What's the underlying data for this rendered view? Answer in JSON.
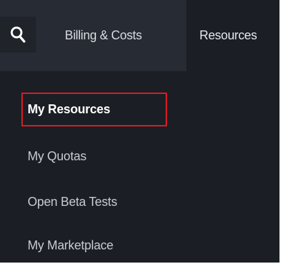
{
  "topnav": {
    "search_icon": "search-icon",
    "items": [
      {
        "label": "Billing & Costs"
      },
      {
        "label": "Resources"
      }
    ]
  },
  "dropdown": {
    "items": [
      {
        "label": "My Resources",
        "selected": true
      },
      {
        "label": "My Quotas"
      },
      {
        "label": "Open Beta Tests"
      },
      {
        "label": "My Marketplace"
      }
    ]
  },
  "colors": {
    "nav_background": "#272c34",
    "menu_background": "#1b1e24",
    "highlight_border": "#e11b22"
  }
}
